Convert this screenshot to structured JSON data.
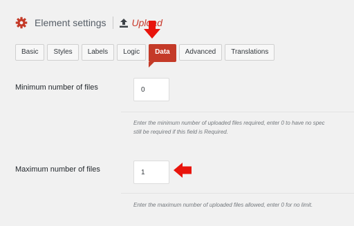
{
  "header": {
    "title": "Element settings",
    "element_type": "Upload"
  },
  "tabs": [
    {
      "label": "Basic",
      "active": false
    },
    {
      "label": "Styles",
      "active": false
    },
    {
      "label": "Labels",
      "active": false
    },
    {
      "label": "Logic",
      "active": false
    },
    {
      "label": "Data",
      "active": true
    },
    {
      "label": "Advanced",
      "active": false
    },
    {
      "label": "Translations",
      "active": false
    }
  ],
  "fields": {
    "min_files": {
      "label": "Minimum number of files",
      "value": "0",
      "help_line1": "Enter the minimum number of uploaded files required, enter 0 to have no spec",
      "help_line2": "still be required if this field is Required."
    },
    "max_files": {
      "label": "Maximum number of files",
      "value": "1",
      "help": "Enter the maximum number of uploaded files allowed, enter 0 for no limit."
    }
  },
  "colors": {
    "accent": "#c43a28",
    "annotation_arrow": "#e8140c",
    "background": "#f1f1f1"
  },
  "icons": {
    "header": "gear-icon",
    "element": "upload-icon",
    "annotations": [
      "arrow-down-icon",
      "arrow-left-icon"
    ]
  }
}
